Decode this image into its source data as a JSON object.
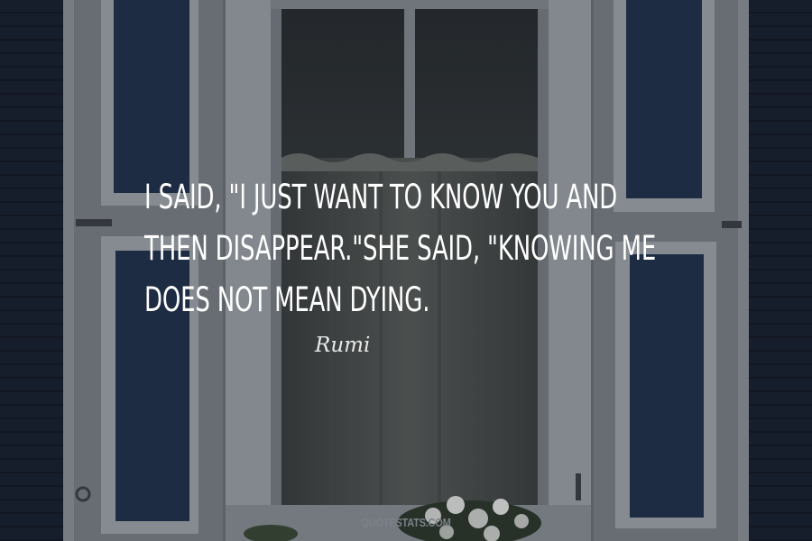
{
  "quote": {
    "lines": [
      "I SAID, \"I JUST WANT TO KNOW YOU AND",
      "THEN DISAPPEAR.\"SHE SAID, \"KNOWING ME",
      "DOES NOT MEAN DYING."
    ],
    "text_color": "#ffffff"
  },
  "author": {
    "name": "Rumi",
    "color": "#e9e9e9"
  },
  "watermark": {
    "text": "QUOTESTATS.COM",
    "color": "#7c8088"
  },
  "background": {
    "subject": "dark blue house wall with white-framed window, sheer curtain and white flowers on sill",
    "colors": {
      "wall": "#1c2331",
      "frame": "#9aa0a6",
      "glass": "#2a2f35",
      "curtain": "#5a5e5c"
    }
  }
}
